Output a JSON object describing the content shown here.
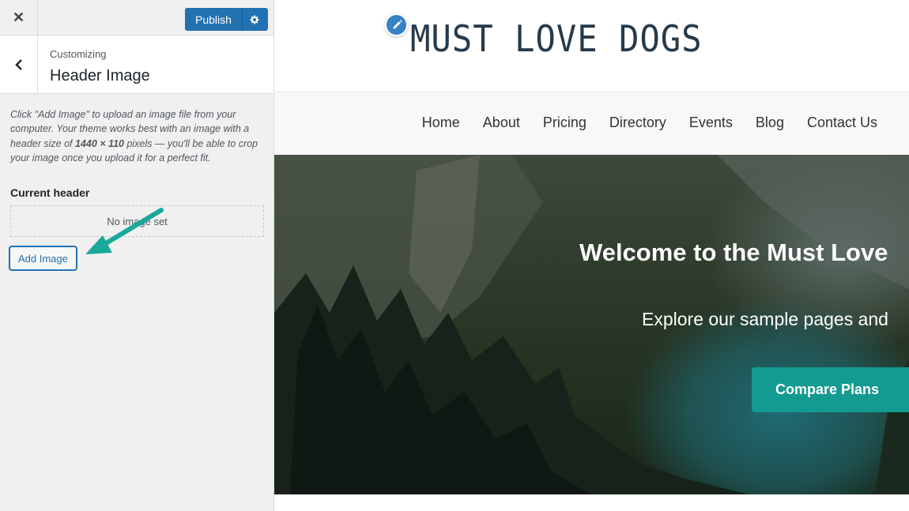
{
  "customizer": {
    "close_label": "✕",
    "publish_label": "Publish",
    "gear_icon": "gear-icon",
    "breadcrumb": "Customizing",
    "section_title": "Header Image",
    "description_part1": "Click \"Add Image\" to upload an image file from your computer. Your theme works best with an image with a header size of ",
    "description_size": "1440 × 110",
    "description_part2": " pixels — you'll be able to crop your image once you upload it for a perfect fit.",
    "current_header_label": "Current header",
    "no_image_text": "No image set",
    "add_image_label": "Add Image",
    "accent_color": "#2271b1"
  },
  "site": {
    "logo_text": "MUST LOVE DOGS",
    "nav": [
      "Home",
      "About",
      "Pricing",
      "Directory",
      "Events",
      "Blog",
      "Contact Us"
    ],
    "hero_title": "Welcome to the Must Love",
    "hero_subtitle": "Explore our sample pages and",
    "cta_label": "Compare Plans",
    "cta_color": "#139a91"
  }
}
